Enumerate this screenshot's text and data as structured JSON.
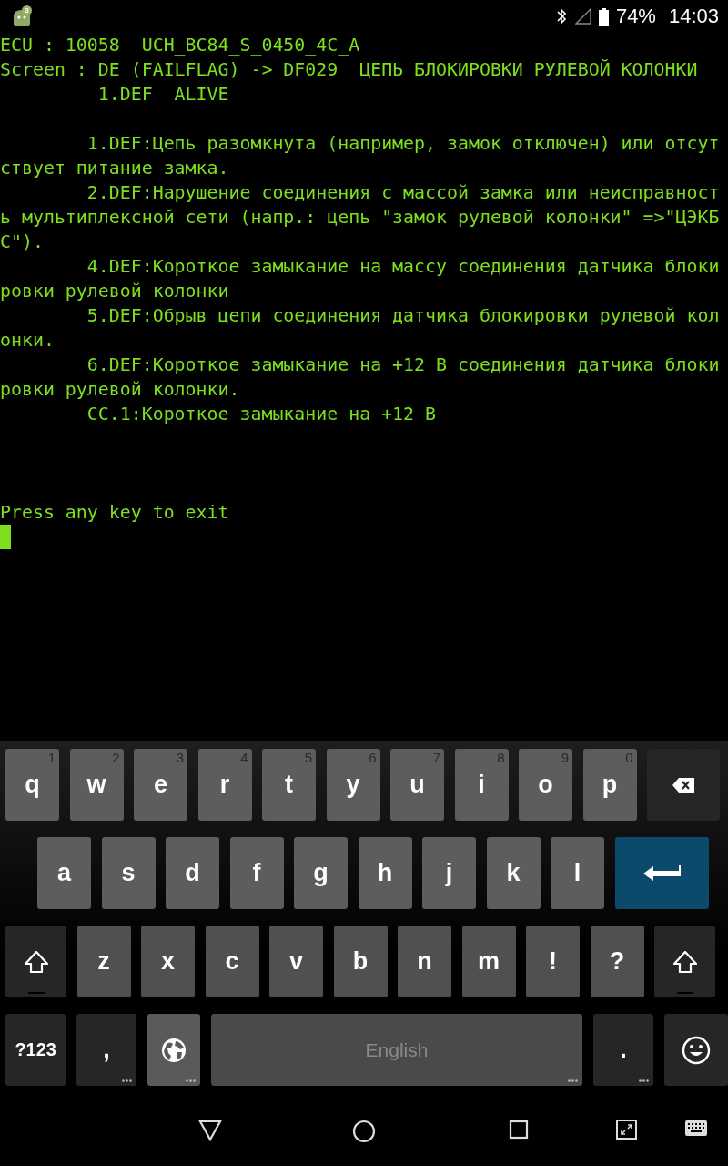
{
  "status_bar": {
    "notification_count": "3",
    "battery": "74%",
    "time": "14:03"
  },
  "terminal": {
    "header": [
      "ECU : 10058  UCH_BC84_S_0450_4C_A",
      "Screen : DE (FAILFLAG) -> DF029  ЦЕПЬ БЛОКИРОВКИ РУЛЕВОЙ КОЛОНКИ",
      "         1.DEF  ALIVE"
    ],
    "faults": [
      "        1.DEF:Цепь разомкнута (например, замок отключен) или отсут",
      "ствует питание замка.",
      "        2.DEF:Нарушение соединения с массой замка или неисправност",
      "ь мультиплексной сети (напр.: цепь \"замок рулевой колонки\" =>\"ЦЭКБ",
      "С\").",
      "        4.DEF:Короткое замыкание на массу соединения датчика блоки",
      "ровки рулевой колонки",
      "        5.DEF:Обрыв цепи соединения датчика блокировки рулевой кол",
      "онки.",
      "        6.DEF:Короткое замыкание на +12 В соединения датчика блоки",
      "ровки рулевой колонки.",
      "        CC.1:Короткое замыкание на +12 В"
    ],
    "prompt": "Press any key to exit"
  },
  "keyboard": {
    "rows": [
      {
        "keys": [
          {
            "kind": "letter",
            "label": "q",
            "hint": "1",
            "more": false
          },
          {
            "kind": "letter",
            "label": "w",
            "hint": "2",
            "more": false
          },
          {
            "kind": "letter",
            "label": "e",
            "hint": "3",
            "more": false
          },
          {
            "kind": "letter",
            "label": "r",
            "hint": "4",
            "more": false
          },
          {
            "kind": "letter",
            "label": "t",
            "hint": "5",
            "more": false
          },
          {
            "kind": "letter",
            "label": "y",
            "hint": "6",
            "more": false
          },
          {
            "kind": "letter",
            "label": "u",
            "hint": "7",
            "more": false
          },
          {
            "kind": "letter",
            "label": "i",
            "hint": "8",
            "more": false
          },
          {
            "kind": "letter",
            "label": "o",
            "hint": "9",
            "more": false
          },
          {
            "kind": "letter",
            "label": "p",
            "hint": "0",
            "more": false
          },
          {
            "kind": "backspace",
            "more": false
          }
        ]
      },
      {
        "keys": [
          {
            "kind": "letter",
            "label": "a",
            "more": false
          },
          {
            "kind": "letter",
            "label": "s",
            "more": false
          },
          {
            "kind": "letter",
            "label": "d",
            "more": false
          },
          {
            "kind": "letter",
            "label": "f",
            "more": false
          },
          {
            "kind": "letter",
            "label": "g",
            "more": false
          },
          {
            "kind": "letter",
            "label": "h",
            "more": false
          },
          {
            "kind": "letter",
            "label": "j",
            "more": false
          },
          {
            "kind": "letter",
            "label": "k",
            "more": false
          },
          {
            "kind": "letter",
            "label": "l",
            "more": false
          },
          {
            "kind": "enter",
            "more": false
          }
        ]
      },
      {
        "keys": [
          {
            "kind": "shift",
            "more": false
          },
          {
            "kind": "letter",
            "label": "z",
            "more": false
          },
          {
            "kind": "letter",
            "label": "x",
            "more": false
          },
          {
            "kind": "letter",
            "label": "c",
            "more": false
          },
          {
            "kind": "letter",
            "label": "v",
            "more": false
          },
          {
            "kind": "letter",
            "label": "b",
            "more": false
          },
          {
            "kind": "letter",
            "label": "n",
            "more": false
          },
          {
            "kind": "letter",
            "label": "m",
            "more": false
          },
          {
            "kind": "letter",
            "label": "!",
            "more": false
          },
          {
            "kind": "letter",
            "label": "?",
            "more": false
          },
          {
            "kind": "shift",
            "more": false
          }
        ]
      },
      {
        "keys": [
          {
            "kind": "dark",
            "label": "?123",
            "more": false
          },
          {
            "kind": "dark",
            "label": ",",
            "more": true
          },
          {
            "kind": "globe",
            "more": true
          },
          {
            "kind": "space",
            "label": "English",
            "more": true
          },
          {
            "kind": "dark",
            "label": ".",
            "more": true
          },
          {
            "kind": "emoji",
            "more": false
          }
        ]
      }
    ]
  }
}
